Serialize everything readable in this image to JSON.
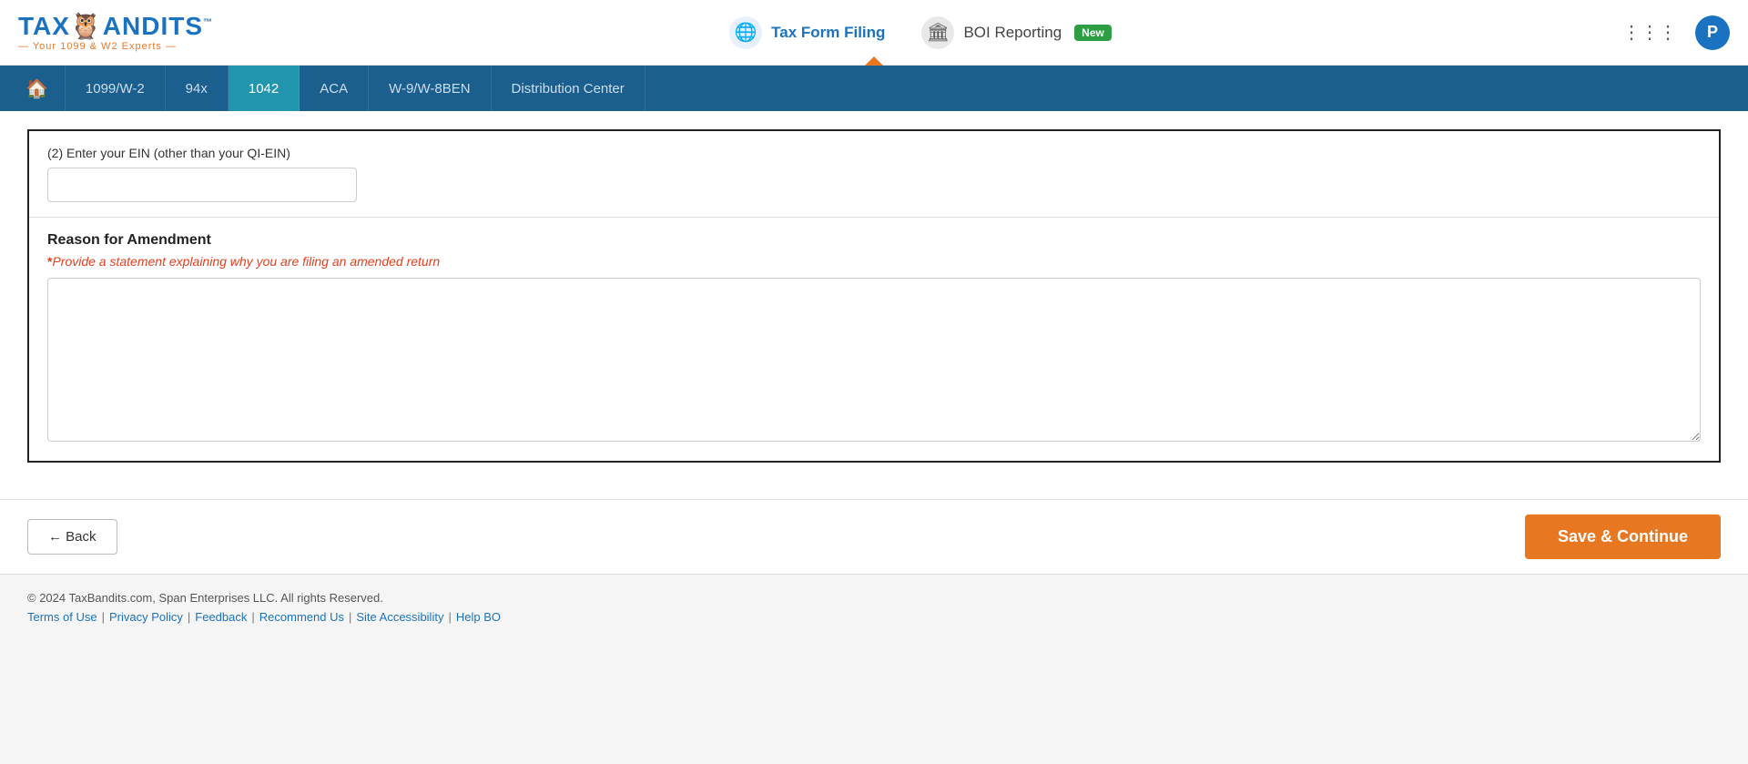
{
  "header": {
    "logo_main": "TAX",
    "logo_owl": "🦉",
    "logo_end": "ANDITS",
    "logo_tm": "™",
    "logo_tagline": "— Your 1099 & W2 Experts —",
    "nav_tax_form": "Tax Form Filing",
    "nav_boi": "BOI Reporting",
    "nav_new_badge": "New",
    "user_initial": "P"
  },
  "top_nav": {
    "items": [
      {
        "label": "🏠",
        "id": "home",
        "active": false
      },
      {
        "label": "1099/W-2",
        "id": "1099",
        "active": false
      },
      {
        "label": "94x",
        "id": "94x",
        "active": false
      },
      {
        "label": "1042",
        "id": "1042",
        "active": true
      },
      {
        "label": "ACA",
        "id": "aca",
        "active": false
      },
      {
        "label": "W-9/W-8BEN",
        "id": "w9",
        "active": false
      },
      {
        "label": "Distribution Center",
        "id": "dist",
        "active": false
      }
    ]
  },
  "form": {
    "ein_label": "(2) Enter your EIN (other than your QI-EIN)",
    "ein_placeholder": "",
    "reason_section_title": "Reason for Amendment",
    "reason_required_note": "Provide a statement explaining why you are filing an amended return",
    "reason_placeholder": ""
  },
  "actions": {
    "back_label": "← Back",
    "save_continue_label": "Save & Continue"
  },
  "footer": {
    "copyright": "© 2024 TaxBandits.com, Span Enterprises LLC. All rights Reserved.",
    "links": [
      {
        "label": "Terms of Use",
        "id": "terms"
      },
      {
        "label": "Privacy Policy",
        "id": "privacy"
      },
      {
        "label": "Feedback",
        "id": "feedback"
      },
      {
        "label": "Recommend Us",
        "id": "recommend"
      },
      {
        "label": "Site Accessibility",
        "id": "accessibility"
      },
      {
        "label": "Help BO",
        "id": "helpbo"
      }
    ]
  }
}
